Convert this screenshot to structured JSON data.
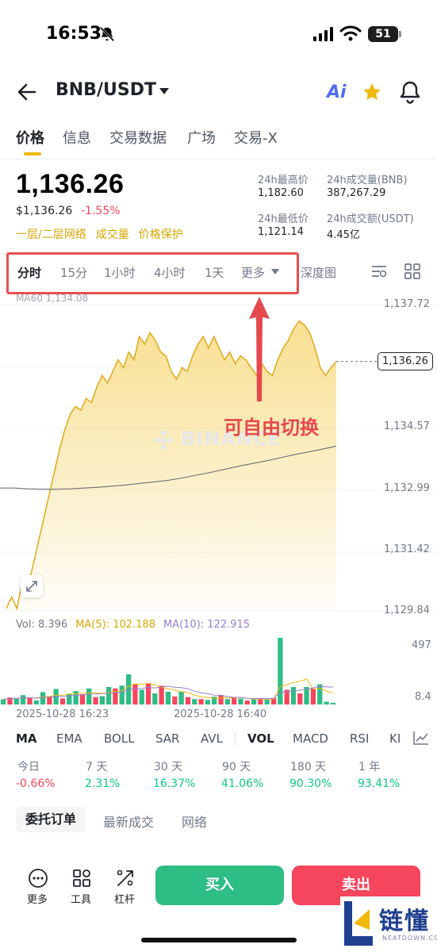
{
  "status_bar": {
    "time": "16:53",
    "battery": "51"
  },
  "header": {
    "pair": "BNB/USDT",
    "ai_label": "Ai"
  },
  "tabs": [
    "价格",
    "信息",
    "交易数据",
    "广场",
    "交易-X"
  ],
  "price": {
    "last": "1,136.26",
    "fiat": "$1,136.26",
    "change": "-1.55%",
    "tags": [
      "一层/二层网络",
      "成交量",
      "价格保护"
    ]
  },
  "stats": {
    "high_label": "24h最高价",
    "high_value": "1,182.60",
    "vol_bnb_label": "24h成交量(BNB)",
    "vol_bnb_value": "387,267.29",
    "low_label": "24h最低价",
    "low_value": "1,121.14",
    "vol_usdt_label": "24h成交额(USDT)",
    "vol_usdt_value": "4.45亿"
  },
  "intervals": [
    "分时",
    "15分",
    "1小时",
    "4小时",
    "1天",
    "更多"
  ],
  "depth_label": "深度图",
  "chart": {
    "ma60_label": "MA60 1,134.08",
    "y_ticks": [
      "1,137.72",
      "1,134.57",
      "1,132.99",
      "1,131.42",
      "1,129.84"
    ],
    "current_price": "1,136.26",
    "annotation": "可自由切换",
    "watermark": "BINANCE",
    "vol_legend": {
      "vol": "Vol: 8.396",
      "ma5": "MA(5): 102.188",
      "ma10": "MA(10): 122.915"
    },
    "vol_ticks": [
      "497",
      "8.4"
    ],
    "x_ticks": [
      "2025-10-28 16:23",
      "2025-10-28 16:40"
    ],
    "colors": {
      "line": "#f0b90b",
      "up": "#2ebd85",
      "down": "#f6465d",
      "ma5": "#f0b90b",
      "ma10": "#9a7ccf"
    }
  },
  "chart_data": {
    "type": "area",
    "ylim": [
      1129.84,
      1137.72
    ],
    "price_series": [
      1129.9,
      1130.2,
      1129.9,
      1130.6,
      1130.4,
      1131.0,
      1131.6,
      1132.2,
      1132.8,
      1133.4,
      1134.0,
      1134.5,
      1134.9,
      1135.1,
      1135.0,
      1135.3,
      1135.2,
      1135.6,
      1135.9,
      1135.7,
      1136.0,
      1136.3,
      1136.1,
      1136.5,
      1136.3,
      1136.9,
      1136.7,
      1137.0,
      1136.8,
      1136.5,
      1136.4,
      1136.0,
      1135.8,
      1136.1,
      1136.0,
      1136.4,
      1136.7,
      1136.9,
      1136.6,
      1136.9,
      1136.6,
      1136.3,
      1136.5,
      1136.2,
      1136.4,
      1136.3,
      1136.1,
      1135.9,
      1136.2,
      1136.0,
      1135.9,
      1136.3,
      1136.6,
      1136.8,
      1137.1,
      1137.3,
      1137.2,
      1137.0,
      1136.6,
      1136.1,
      1135.9,
      1136.1,
      1136.26
    ],
    "ma60_series": [
      1133.0,
      1133.0,
      1132.98,
      1132.97,
      1132.97,
      1132.98,
      1133.0,
      1133.02,
      1133.05,
      1133.08,
      1133.12,
      1133.16,
      1133.2,
      1133.26,
      1133.33,
      1133.4,
      1133.48,
      1133.56,
      1133.63,
      1133.7,
      1133.78,
      1133.86,
      1133.93,
      1134.0,
      1134.08
    ],
    "volumes": [
      38,
      52,
      44,
      70,
      48,
      30,
      92,
      60,
      116,
      45,
      80,
      100,
      76,
      120,
      55,
      62,
      130,
      120,
      140,
      225,
      150,
      110,
      160,
      82,
      140,
      95,
      60,
      96,
      55,
      40,
      40,
      34,
      58,
      70,
      40,
      48,
      44,
      30,
      38,
      46,
      36,
      48,
      497,
      110,
      130,
      82,
      130,
      118,
      150,
      20,
      12
    ],
    "vol_up": [
      true,
      false,
      true,
      true,
      false,
      true,
      true,
      false,
      true,
      false,
      true,
      true,
      false,
      true,
      false,
      true,
      true,
      false,
      true,
      true,
      false,
      true,
      false,
      true,
      false,
      true,
      false,
      true,
      false,
      true,
      false,
      true,
      true,
      false,
      true,
      false,
      true,
      false,
      true,
      false,
      true,
      false,
      true,
      false,
      true,
      false,
      true,
      false,
      true,
      true,
      true
    ],
    "vol_ylim": [
      0,
      497
    ]
  },
  "indicators": [
    "MA",
    "EMA",
    "BOLL",
    "SAR",
    "AVL",
    "VOL",
    "MACD",
    "RSI",
    "KI"
  ],
  "performance": [
    {
      "label": "今日",
      "value": "-0.66%"
    },
    {
      "label": "7 天",
      "value": "2.31%"
    },
    {
      "label": "30 天",
      "value": "16.37%"
    },
    {
      "label": "90 天",
      "value": "41.06%"
    },
    {
      "label": "180 天",
      "value": "90.30%"
    },
    {
      "label": "1 年",
      "value": "93.41%"
    }
  ],
  "order_tabs": [
    "委托订单",
    "最新成交",
    "网络"
  ],
  "bottom": {
    "more": "更多",
    "tools": "工具",
    "leverage": "杠杆",
    "buy": "买入",
    "sell": "卖出"
  },
  "brand": {
    "name": "链懂",
    "sub": "NEATDOWN.COM"
  }
}
